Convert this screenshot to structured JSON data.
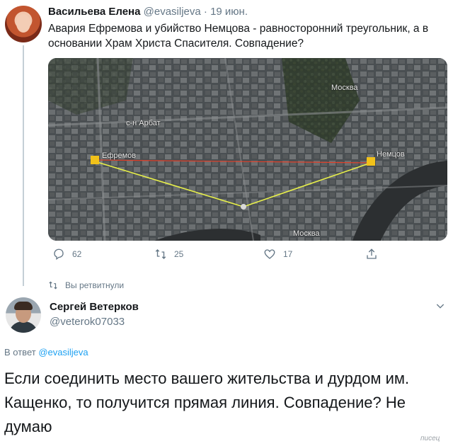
{
  "tweet1": {
    "author_name": "Васильева Елена",
    "handle": "@evasiljeva",
    "separator": " · ",
    "date": "19 июн.",
    "text": "Авария Ефремова и убийство Немцова - равносторонний треугольник, а в основании Храм Христа Спасителя. Совпадение?",
    "map": {
      "labels": {
        "arbat": "с-н Арбат",
        "moskva_top": "Москва",
        "efremov": "Ефремов",
        "nemtsov": "Немцов",
        "moskva_bottom": "Москва"
      },
      "colors": {
        "triangle": "#e8f04a",
        "base_line": "#e0402a",
        "pin": "#f2c21a"
      }
    },
    "actions": {
      "reply_count": "62",
      "retweet_count": "25",
      "like_count": "17"
    },
    "icons": [
      "reply-icon",
      "retweet-icon",
      "like-icon",
      "share-icon"
    ]
  },
  "retweet_notice": "Вы ретвитнули",
  "tweet2": {
    "author_name": "Сергей Ветерков",
    "handle": "@veterok07033",
    "reply_prefix": "В ответ ",
    "reply_handle": "@evasiljeva",
    "text": "Если соединить место вашего жительства и дурдом им. Кащенко, то получится прямая линия. Совпадение? Не думаю"
  },
  "watermark": "писец"
}
